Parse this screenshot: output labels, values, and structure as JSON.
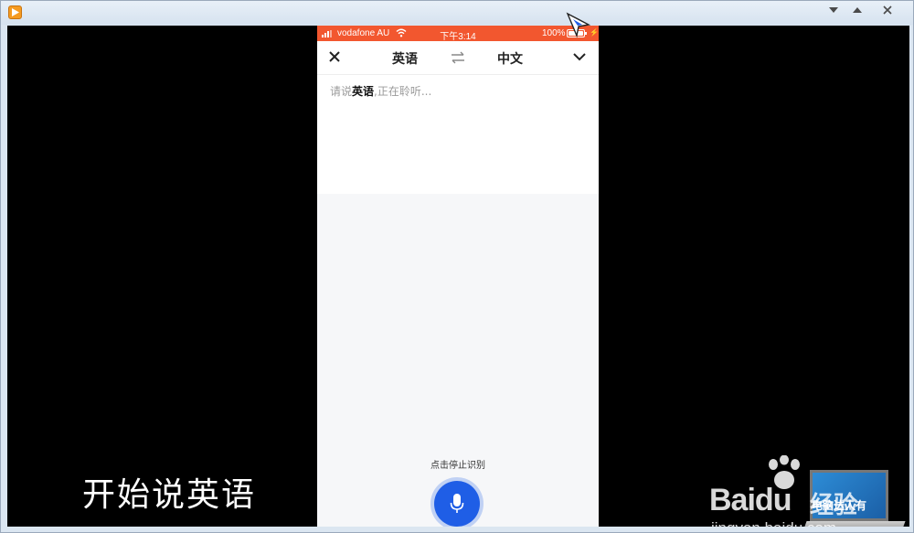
{
  "phone": {
    "status": {
      "carrier": "vodafone AU",
      "time": "下午3:14",
      "battery": "100%"
    },
    "nav": {
      "source_lang": "英语",
      "target_lang": "中文"
    },
    "prompt": {
      "before": "请说",
      "lang": "英语",
      "after": ",正在聆听..."
    },
    "stop_hint": "点击停止识别"
  },
  "caption": "开始说英语",
  "watermark": {
    "logo_bai": "Bai",
    "logo_du": "du",
    "logo_jy": "经验",
    "url": "jingyan.baidu.com",
    "laptop_text": "电脑达人有"
  },
  "colors": {
    "statusbar": "#f2572f",
    "mic": "#1f5ee6",
    "video_bg": "#000000"
  },
  "icons": {
    "close": "close-icon",
    "swap": "swap-icon",
    "chevron": "chevron-down-icon",
    "mic": "microphone-icon"
  }
}
